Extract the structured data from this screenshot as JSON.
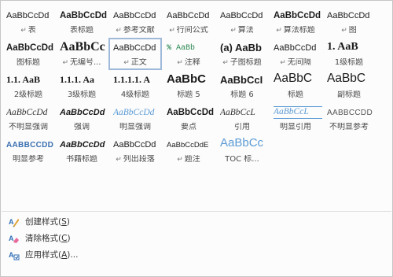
{
  "styles": [
    {
      "preview": "AaBbCcDd",
      "label": "表",
      "mark": true,
      "variant": "s-normal"
    },
    {
      "preview": "AaBbCcDd",
      "label": "表标题",
      "mark": false,
      "variant": "s-bold"
    },
    {
      "preview": "AaBbCcDd",
      "label": "参考文献",
      "mark": true,
      "variant": "s-normal"
    },
    {
      "preview": "AaBbCcDd",
      "label": "行间公式",
      "mark": true,
      "variant": "s-normal"
    },
    {
      "preview": "AaBbCcDd",
      "label": "算法",
      "mark": true,
      "variant": "s-normal"
    },
    {
      "preview": "AaBbCcDd",
      "label": "算法标题",
      "mark": true,
      "variant": "s-bold"
    },
    {
      "preview": "AaBbCcDd",
      "label": "图",
      "mark": true,
      "variant": "s-normal"
    },
    {
      "preview": "AaBbCcDd",
      "label": "图标题",
      "mark": false,
      "variant": "s-bold"
    },
    {
      "preview": "AaBbCc",
      "label": "无编号...",
      "mark": true,
      "variant": "s-h-big"
    },
    {
      "preview": "AaBbCcDd",
      "label": "正文",
      "mark": true,
      "variant": "s-normal",
      "selected": true
    },
    {
      "preview": "AaBb",
      "prefix": "%",
      "label": "注释",
      "mark": true,
      "variant": "s-code"
    },
    {
      "preview": "(a) AaBb",
      "label": "子图标题",
      "mark": true,
      "variant": "s-h-med2"
    },
    {
      "preview": "AaBbCcDd",
      "label": "无间隔",
      "mark": true,
      "variant": "s-normal"
    },
    {
      "preview": "1.  AaB",
      "label": "1级标题",
      "mark": false,
      "variant": "s-h-num"
    },
    {
      "preview": "1.1.  AaB",
      "label": "2级标题",
      "mark": false,
      "variant": "s-h-small"
    },
    {
      "preview": "1.1.1.  Aa",
      "label": "3级标题",
      "mark": false,
      "variant": "s-h-small"
    },
    {
      "preview": "1.1.1.1.  A",
      "label": "4级标题",
      "mark": false,
      "variant": "s-h-small"
    },
    {
      "preview": "AaBbC",
      "label": "标题 5",
      "mark": false,
      "variant": "s-h-med"
    },
    {
      "preview": "AaBbCcI",
      "label": "标题 6",
      "mark": false,
      "variant": "s-h-med2"
    },
    {
      "preview": "AaBbC",
      "label": "标题",
      "mark": false,
      "variant": "s-title"
    },
    {
      "preview": "AaBbC",
      "label": "副标题",
      "mark": false,
      "variant": "s-subtitle"
    },
    {
      "preview": "AaBbCcDd",
      "label": "不明显强调",
      "mark": false,
      "variant": "s-italic"
    },
    {
      "preview": "AaBbCcDd",
      "label": "强调",
      "mark": false,
      "variant": "s-italic-bold"
    },
    {
      "preview": "AaBbCcDd",
      "label": "明显强调",
      "mark": false,
      "variant": "s-blue-i"
    },
    {
      "preview": "AaBbCcDd",
      "label": "要点",
      "mark": false,
      "variant": "s-bold"
    },
    {
      "preview": "AaBbCcL",
      "label": "引用",
      "mark": false,
      "variant": "s-italic"
    },
    {
      "preview": "AaBbCcL",
      "label": "明显引用",
      "mark": false,
      "variant": "s-blue-i-ul"
    },
    {
      "preview": "AABBCCDD",
      "label": "不明显参考",
      "mark": false,
      "variant": "s-smallcaps"
    },
    {
      "preview": "AABBCCDD",
      "label": "明显参考",
      "mark": false,
      "variant": "s-smallcaps-b"
    },
    {
      "preview": "AaBbCcDd",
      "label": "书籍标题",
      "mark": false,
      "variant": "s-italic-bold"
    },
    {
      "preview": "AaBbCcDd",
      "label": "列出段落",
      "mark": true,
      "variant": "s-normal"
    },
    {
      "preview": "AaBbCcDdE",
      "label": "题注",
      "mark": true,
      "variant": "s-small"
    },
    {
      "preview": "AaBbCc",
      "label": "TOC 标...",
      "mark": false,
      "variant": "s-toc"
    }
  ],
  "menu": [
    {
      "label": "创建样式(",
      "accel": "S",
      "tail": ")",
      "icon": "create-style-icon"
    },
    {
      "label": "清除格式(",
      "accel": "C",
      "tail": ")",
      "icon": "clear-format-icon"
    },
    {
      "label": "应用样式(",
      "accel": "A",
      "tail": ")...",
      "icon": "apply-style-icon"
    }
  ],
  "colors": {
    "accent": "#5b9bd5",
    "selection_border": "#9fb9da"
  },
  "pilcrow": "↵"
}
